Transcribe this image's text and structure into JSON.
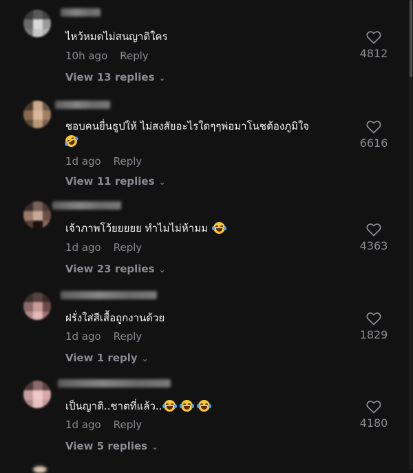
{
  "comments": [
    {
      "text": "ไหว้หมดไม่สนญาติใคร",
      "time": "10h ago",
      "reply_label": "Reply",
      "view_replies": "View 13 replies",
      "likes": "4812",
      "emojis": []
    },
    {
      "text": "ชอบคนยื่นธูปให้ ไม่สงสัยอะไรใดๆๆพ่อมาโนชต้องภูมิใจ",
      "time": "1d ago",
      "reply_label": "Reply",
      "view_replies": "View 11 replies",
      "likes": "6616",
      "emojis": [
        "rolling-on-floor-laughing"
      ]
    },
    {
      "text": "เจ้าภาพโว้ยยยยย ทำไมไม่ห้ามม",
      "time": "1d ago",
      "reply_label": "Reply",
      "view_replies": "View 23 replies",
      "likes": "4363",
      "emojis": [
        "face-with-tears-of-joy"
      ]
    },
    {
      "text": "ฝรั่งใส่สีเสื้อถูกงานด้วย",
      "time": "1d ago",
      "reply_label": "Reply",
      "view_replies": "View 1 reply",
      "likes": "1829",
      "emojis": []
    },
    {
      "text": "เป็นญาติ..ชาตที่แล้ว..",
      "time": "1d ago",
      "reply_label": "Reply",
      "view_replies": "View 5 replies",
      "likes": "4180",
      "emojis": [
        "face-with-tears-of-joy",
        "face-with-tears-of-joy",
        "face-with-tears-of-joy"
      ]
    }
  ],
  "icons": {
    "like": "heart-outline-icon",
    "chevron": "chevron-down-icon"
  },
  "colors": {
    "background": "#121212",
    "text": "#f1f1f2",
    "muted": "#8a8b91"
  }
}
